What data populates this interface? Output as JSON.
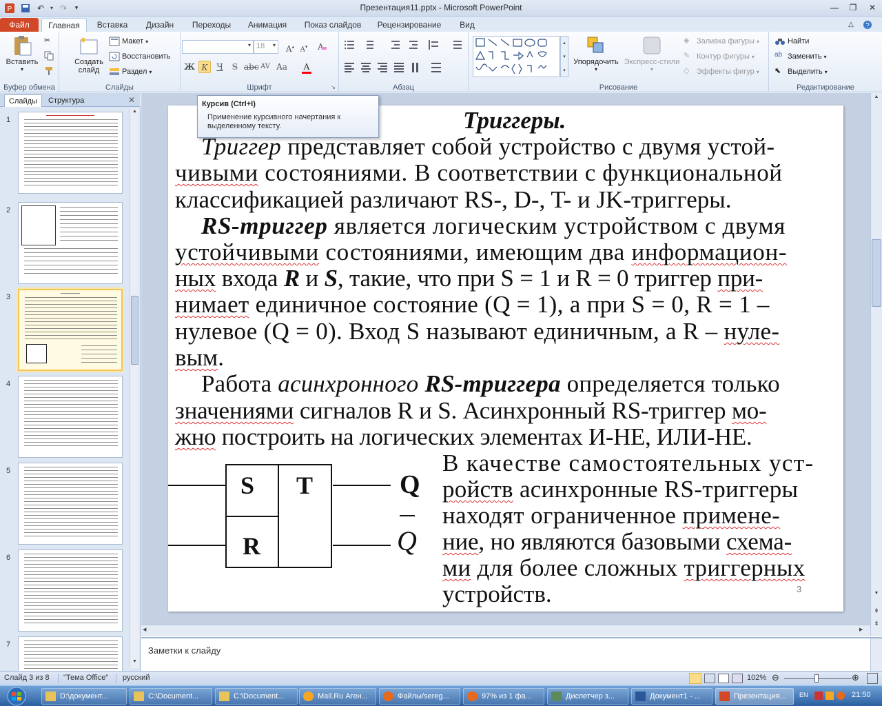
{
  "window": {
    "title": "Презентация11.pptx - Microsoft PowerPoint"
  },
  "ribbon": {
    "tabs": [
      "Файл",
      "Главная",
      "Вставка",
      "Дизайн",
      "Переходы",
      "Анимация",
      "Показ слайдов",
      "Рецензирование",
      "Вид"
    ],
    "active_tab": "Главная",
    "groups": {
      "clipboard": {
        "label": "Буфер обмена",
        "paste": "Вставить"
      },
      "slides": {
        "label": "Слайды",
        "new_slide_1": "Создать",
        "new_slide_2": "слайд",
        "layout": "Макет",
        "reset": "Восстановить",
        "section": "Раздел"
      },
      "font": {
        "label": "Шрифт",
        "size": "18"
      },
      "paragraph": {
        "label": "Абзац"
      },
      "drawing": {
        "label": "Рисование",
        "arrange": "Упорядочить",
        "quick_styles": "Экспресс-стили",
        "fill": "Заливка фигуры",
        "outline": "Контур фигуры",
        "effects": "Эффекты фигур"
      },
      "editing": {
        "label": "Редактирование",
        "find": "Найти",
        "replace": "Заменить",
        "select": "Выделить"
      }
    }
  },
  "tooltip": {
    "title": "Курсив (Ctrl+I)",
    "description_line1": "Применение курсивного начертания к",
    "description_line2": "выделенному тексту."
  },
  "left_panel": {
    "tabs": [
      "Слайды",
      "Структура"
    ],
    "slide_numbers": [
      "1",
      "2",
      "3",
      "4",
      "5",
      "6",
      "7"
    ]
  },
  "slide": {
    "title": "Триггеры.",
    "p1": [
      "Триггер",
      "представляет собой устройство с двумя устой-",
      "чивыми",
      "состояниями. В соответствии с функциональной",
      "классификацией различают RS-, D-, T- и JK-триггеры."
    ],
    "p2": [
      "RS-триггер",
      "является логическим устройством с двумя",
      "устойчивыми",
      "состояниями, имеющим два",
      "информацион-",
      "ных",
      "входа",
      "R",
      "и",
      "S",
      ", такие, что при S = 1 и R = 0 триггер",
      "при-",
      "нимает",
      "единичное состояние (Q = 1), а при S = 0, R = 1 –",
      "нулевое (Q = 0). Вход S называют единичным, а R –",
      "нуле-",
      "вым",
      "."
    ],
    "p3": [
      "Работа",
      "асинхронного",
      "RS-триггера",
      "определяется только",
      "значениями",
      "сигналов R и S. Асинхронный RS-триггер",
      "мо-",
      "жно",
      "построить на логических элементах И-НЕ, ИЛИ-НЕ."
    ],
    "p4": [
      "В качестве самостоятельных уст-",
      "ройств",
      "асинхронные RS-триггеры",
      "находят ограниченное",
      "примене-",
      "ние",
      ", но являются базовыми",
      "схема-",
      "ми",
      "для более сложных",
      "триггерных",
      "устройств."
    ],
    "diagram": {
      "s": "S",
      "t": "T",
      "r": "R",
      "q": "Q",
      "qbar": "Q"
    },
    "page_number": "3"
  },
  "notes": {
    "placeholder": "Заметки к слайду"
  },
  "status": {
    "slide": "Слайд 3 из 8",
    "theme": "\"Тема Office\"",
    "language": "русский",
    "zoom": "102%"
  },
  "taskbar": {
    "items": [
      "D:\\документ...",
      "C:\\Document...",
      "C:\\Document...",
      "Mail.Ru Аген...",
      "Файлы/sereg...",
      "97% из 1 фа...",
      "Диспетчер з...",
      "Документ1 - ...",
      "Презентация..."
    ],
    "clock": "21:50"
  },
  "colors": {
    "file_tab": "#d24726",
    "ribbon": "#dfe8f5",
    "selection": "#f3c55a",
    "taskbar": "#2a5fa0"
  }
}
